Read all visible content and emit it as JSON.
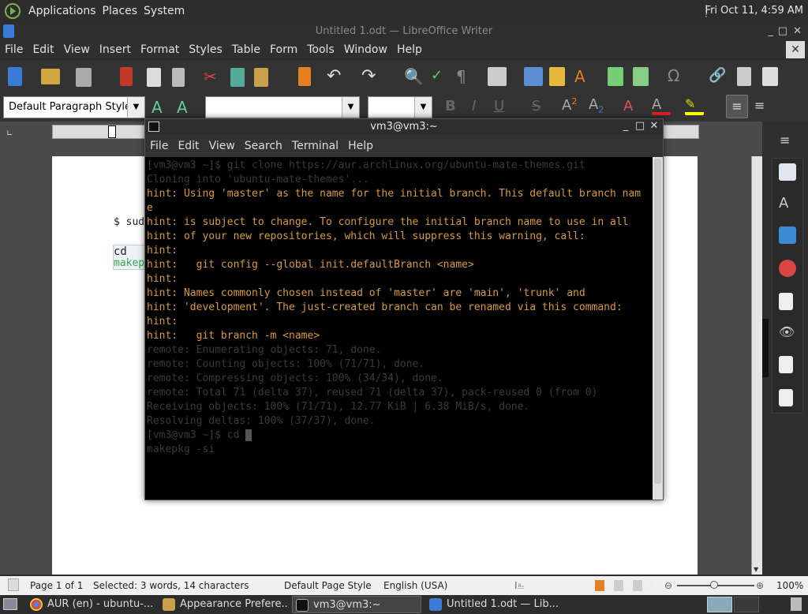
{
  "top_panel": {
    "menus": [
      "Applications",
      "Places",
      "System"
    ],
    "clock": "Fri Oct 11, 4:59 AM"
  },
  "writer": {
    "title": "Untitled 1.odt — LibreOffice Writer",
    "menus": [
      "File",
      "Edit",
      "View",
      "Insert",
      "Format",
      "Styles",
      "Table",
      "Form",
      "Tools",
      "Window",
      "Help"
    ],
    "paragraph_style": "Default Paragraph Style",
    "document_lines": [
      "$ sud",
      "cd",
      "makep"
    ]
  },
  "terminal": {
    "title": "vm3@vm3:~",
    "menus": [
      "File",
      "Edit",
      "View",
      "Search",
      "Terminal",
      "Help"
    ],
    "lines": [
      {
        "text": "[vm3@vm3 ~]$ git clone https://aur.archlinux.org/ubuntu-mate-themes.git",
        "style": "dim"
      },
      {
        "text": "Cloning into 'ubuntu-mate-themes'...",
        "style": "dim"
      },
      {
        "text": "hint: Using 'master' as the name for the initial branch. This default branch nam",
        "style": "hint"
      },
      {
        "text": "e",
        "style": "hint"
      },
      {
        "text": "hint: is subject to change. To configure the initial branch name to use in all",
        "style": "hint"
      },
      {
        "text": "hint: of your new repositories, which will suppress this warning, call:",
        "style": "hint"
      },
      {
        "text": "hint:",
        "style": "hint"
      },
      {
        "text": "hint:   git config --global init.defaultBranch <name>",
        "style": "hint"
      },
      {
        "text": "hint:",
        "style": "hint"
      },
      {
        "text": "hint: Names commonly chosen instead of 'master' are 'main', 'trunk' and",
        "style": "hint"
      },
      {
        "text": "hint: 'development'. The just-created branch can be renamed via this command:",
        "style": "hint"
      },
      {
        "text": "hint:",
        "style": "hint"
      },
      {
        "text": "hint:   git branch -m <name>",
        "style": "hint"
      },
      {
        "text": "remote: Enumerating objects: 71, done.",
        "style": "dim"
      },
      {
        "text": "remote: Counting objects: 100% (71/71), done.",
        "style": "dim"
      },
      {
        "text": "remote: Compressing objects: 100% (34/34), done.",
        "style": "dim"
      },
      {
        "text": "remote: Total 71 (delta 37), reused 71 (delta 37), pack-reused 0 (from 0)",
        "style": "dim"
      },
      {
        "text": "Receiving objects: 100% (71/71), 12.77 KiB | 6.38 MiB/s, done.",
        "style": "dim"
      },
      {
        "text": "Resolving deltas: 100% (37/37), done.",
        "style": "dim"
      },
      {
        "text": "[vm3@vm3 ~]$ cd ",
        "style": "dim"
      },
      {
        "text": "makepkg -si",
        "style": "dim"
      }
    ]
  },
  "statusbar": {
    "page": "Page 1 of 1",
    "selection": "Selected: 3 words, 14 characters",
    "page_style": "Default Page Style",
    "language": "English (USA)",
    "zoom": "100%"
  },
  "taskbar": {
    "tasks": [
      {
        "label": "AUR (en) - ubuntu-...",
        "icon": "chrome-icon"
      },
      {
        "label": "Appearance Prefere...",
        "icon": "appearance-icon"
      },
      {
        "label": "vm3@vm3:~",
        "icon": "terminal-icon"
      },
      {
        "label": "Untitled 1.odt — Lib...",
        "icon": "writer-icon"
      }
    ]
  }
}
